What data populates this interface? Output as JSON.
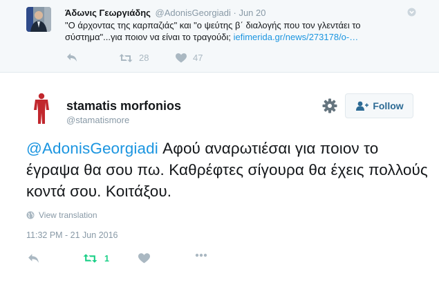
{
  "parent_tweet": {
    "author_name": "Άδωνις Γεωργιάδης",
    "author_handle": "@AdonisGeorgiadi",
    "separator": "·",
    "date": "Jun 20",
    "text": "\"Ο άρχοντας της καρπαζιάς\" και \"ο ψεύτης β΄ διαλογής που τον γλεντάει το σύστημα\"...για ποιον να είναι το τραγούδι; ",
    "link": "iefimerida.gr/news/273178/ο-…",
    "retweet_count": "28",
    "like_count": "47",
    "icons": [
      "reply-icon",
      "retweet-icon",
      "heart-icon",
      "chevron-down-icon"
    ]
  },
  "tweet": {
    "author_name": "stamatis morfonios",
    "author_handle": "@stamatismore",
    "follow_label": "Follow",
    "mention": "@AdonisGeorgiadi",
    "text": " Αφού αναρωτιέσαι για ποιον το έγραψα θα σου πω. Καθρέφτες σίγουρα θα έχεις πολλούς κοντά σου. Κοιτάξου.",
    "translate_label": "View translation",
    "timestamp": "11:32 PM - 21 Jun 2016",
    "retweet_count": "1",
    "icons": [
      "gear-icon",
      "follow-user-icon",
      "globe-icon",
      "reply-icon",
      "retweet-icon",
      "heart-icon",
      "more-icon"
    ],
    "colors": {
      "link": "#1b95e0",
      "retweet_active": "#19cf86",
      "muted": "#8899a6"
    }
  }
}
